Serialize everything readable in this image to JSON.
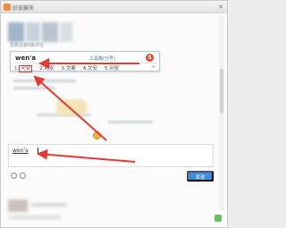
{
  "window": {
    "title": "好友聊天"
  },
  "caption": "查看全部4条评论",
  "ime": {
    "composition": "wen'a",
    "toolbox_label": "工具箱(分号)",
    "candidates": [
      {
        "index": "1.",
        "text": "问安"
      },
      {
        "index": "2.",
        "text": "吻安"
      },
      {
        "index": "3.",
        "text": "文案"
      },
      {
        "index": "4.",
        "text": "文安"
      },
      {
        "index": "5.",
        "text": "问安"
      }
    ],
    "next_symbol": ">"
  },
  "input": {
    "value": "wen'a"
  },
  "send_label": "发送",
  "icons": {
    "app": "app-icon",
    "close": "close-icon",
    "ime_logo": "sogou-logo-icon",
    "emoji": "emoji-icon",
    "at": "at-icon",
    "corner": "corner-icon"
  },
  "colors": {
    "arrow": "#e53935",
    "send_button": "#3b8ee6",
    "highlight": "#dd2222"
  }
}
